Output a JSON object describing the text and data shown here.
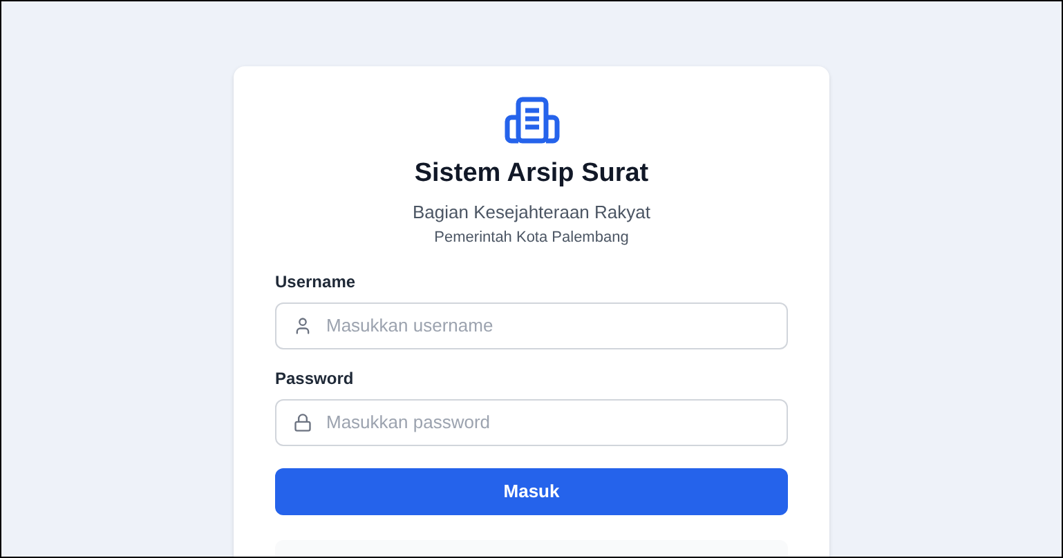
{
  "title": "Sistem Arsip Surat",
  "subtitle": "Bagian Kesejahteraan Rakyat",
  "organization": "Pemerintah Kota Palembang",
  "fields": [
    {
      "kind": "user",
      "label": "Username",
      "placeholder": "Masukkan username"
    },
    {
      "kind": "lock",
      "label": "Password",
      "placeholder": "Masukkan password"
    }
  ],
  "submit": "Masuk"
}
